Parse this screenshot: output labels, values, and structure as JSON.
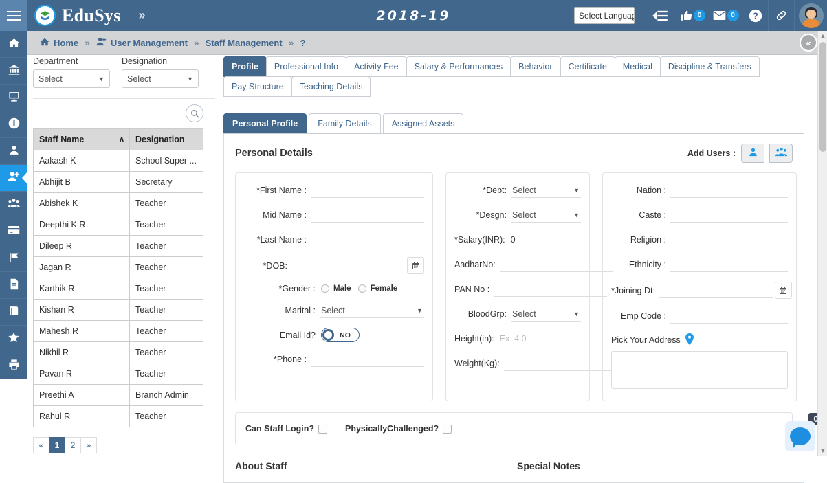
{
  "topbar": {
    "brand": "EduSys",
    "expand_icon": "chevron-double-right-icon",
    "year_title": "2018-19",
    "language_selector": {
      "value": "Select Languag",
      "caret": "▼"
    },
    "icons": [
      {
        "name": "list-menu-icon",
        "glyph": "≡"
      },
      {
        "name": "thumbs-up-icon",
        "glyph": "👍",
        "badge": "0"
      },
      {
        "name": "envelope-icon",
        "glyph": "✉",
        "badge": "0"
      },
      {
        "name": "help-icon",
        "glyph": "?"
      },
      {
        "name": "link-icon",
        "glyph": "🔗"
      }
    ],
    "avatar_name": "user-avatar"
  },
  "sidebar": {
    "items": [
      {
        "name": "home",
        "icon": "home-icon",
        "active": false
      },
      {
        "name": "institution",
        "icon": "bank-icon",
        "active": false
      },
      {
        "name": "dashboard",
        "icon": "monitor-icon",
        "active": false
      },
      {
        "name": "information",
        "icon": "info-icon",
        "active": false
      },
      {
        "name": "user",
        "icon": "user-icon",
        "active": false
      },
      {
        "name": "user-management",
        "icon": "user-plus-icon",
        "active": true
      },
      {
        "name": "groups",
        "icon": "users-group-icon",
        "active": false
      },
      {
        "name": "payments",
        "icon": "card-icon",
        "active": false
      },
      {
        "name": "reports-flag",
        "icon": "flag-icon",
        "active": false
      },
      {
        "name": "documents",
        "icon": "file-icon",
        "active": false
      },
      {
        "name": "library",
        "icon": "book-icon",
        "active": false
      },
      {
        "name": "favorites",
        "icon": "star-icon",
        "active": false
      },
      {
        "name": "print",
        "icon": "printer-icon",
        "active": false
      }
    ]
  },
  "breadcrumb": {
    "items": [
      {
        "label": "Home",
        "icon": "home-icon"
      },
      {
        "label": "User Management",
        "icon": "user-plus-icon"
      },
      {
        "label": "Staff Management",
        "icon": ""
      },
      {
        "label": "?",
        "icon": ""
      }
    ],
    "separator": "»",
    "collapse_button": "«"
  },
  "left_panel": {
    "filters": [
      {
        "label": "Department",
        "value": "Select"
      },
      {
        "label": "Designation",
        "value": "Select"
      }
    ],
    "search_icon": "search-icon",
    "table": {
      "headers": [
        "Staff Name",
        "Designation"
      ],
      "sort_indicator": "∧",
      "rows": [
        {
          "name": "Aakash K",
          "designation": "School Super ..."
        },
        {
          "name": "Abhijit B",
          "designation": "Secretary"
        },
        {
          "name": "Abishek K",
          "designation": "Teacher"
        },
        {
          "name": "Deepthi K R",
          "designation": "Teacher"
        },
        {
          "name": "Dileep R",
          "designation": "Teacher"
        },
        {
          "name": "Jagan R",
          "designation": "Teacher"
        },
        {
          "name": "Karthik R",
          "designation": "Teacher"
        },
        {
          "name": "Kishan R",
          "designation": "Teacher"
        },
        {
          "name": "Mahesh R",
          "designation": "Teacher"
        },
        {
          "name": "Nikhil R",
          "designation": "Teacher"
        },
        {
          "name": "Pavan R",
          "designation": "Teacher"
        },
        {
          "name": "Preethi A",
          "designation": "Branch Admin"
        },
        {
          "name": "Rahul R",
          "designation": "Teacher"
        }
      ]
    },
    "pagination": {
      "first": "«",
      "pages": [
        "1",
        "2"
      ],
      "active": "1",
      "last": "»"
    }
  },
  "main": {
    "outer_tabs": [
      {
        "label": "Profile",
        "active": true
      },
      {
        "label": "Professional Info",
        "active": false
      },
      {
        "label": "Activity Fee",
        "active": false
      },
      {
        "label": "Salary & Performances",
        "active": false
      },
      {
        "label": "Behavior",
        "active": false
      },
      {
        "label": "Certificate",
        "active": false
      },
      {
        "label": "Medical",
        "active": false
      },
      {
        "label": "Discipline & Transfers",
        "active": false
      },
      {
        "label": "Pay Structure",
        "active": false
      },
      {
        "label": "Teaching Details",
        "active": false
      }
    ],
    "sub_tabs": [
      {
        "label": "Personal Profile",
        "active": true
      },
      {
        "label": "Family Details",
        "active": false
      },
      {
        "label": "Assigned Assets",
        "active": false
      }
    ],
    "panel_title": "Personal Details",
    "add_users": {
      "label": "Add Users :",
      "single_icon": "add-single-user-icon",
      "group_icon": "add-group-users-icon"
    },
    "column1": {
      "first_name": {
        "label": "*First Name :",
        "value": ""
      },
      "mid_name": {
        "label": "Mid Name :",
        "value": ""
      },
      "last_name": {
        "label": "*Last Name :",
        "value": ""
      },
      "dob": {
        "label": "*DOB:",
        "value": "",
        "calendar_icon": "calendar-icon"
      },
      "gender": {
        "label": "*Gender :",
        "options": [
          "Male",
          "Female"
        ],
        "selected": ""
      },
      "marital": {
        "label": "Marital :",
        "value": "Select"
      },
      "email_id": {
        "label": "Email Id?",
        "toggle_state": "NO"
      },
      "phone": {
        "label": "*Phone :",
        "value": ""
      }
    },
    "column2": {
      "dept": {
        "label": "*Dept:",
        "value": "Select"
      },
      "desgn": {
        "label": "*Desgn:",
        "value": "Select"
      },
      "salary": {
        "label": "*Salary(INR):",
        "value": "0"
      },
      "aadhar": {
        "label": "AadharNo:",
        "value": ""
      },
      "pan": {
        "label": "PAN No :",
        "value": ""
      },
      "bloodgrp": {
        "label": "BloodGrp:",
        "value": "Select"
      },
      "height": {
        "label": "Height(in):",
        "value": "",
        "placeholder": "Ex: 4.0"
      },
      "weight": {
        "label": "Weight(Kg):",
        "value": ""
      }
    },
    "column3": {
      "nation": {
        "label": "Nation :",
        "value": ""
      },
      "caste": {
        "label": "Caste :",
        "value": ""
      },
      "religion": {
        "label": "Religion :",
        "value": ""
      },
      "ethnicity": {
        "label": "Ethnicity :",
        "value": ""
      },
      "joining_dt": {
        "label": "*Joining Dt:",
        "value": "",
        "calendar_icon": "calendar-icon"
      },
      "emp_code": {
        "label": "Emp Code :",
        "value": ""
      },
      "pick_address": {
        "label": "Pick Your Address",
        "icon": "map-pin-icon",
        "value": ""
      }
    },
    "checkboxes": [
      {
        "label": "Can Staff Login?",
        "checked": false
      },
      {
        "label": "PhysicallyChallenged?",
        "checked": false
      }
    ],
    "bottom_sections": [
      {
        "title": "About Staff"
      },
      {
        "title": "Special Notes"
      }
    ]
  },
  "chat_widget": {
    "icon": "chat-bubble-icon",
    "badge": "0"
  },
  "colors": {
    "header_blue": "#41678d",
    "accent_blue": "#1e9ae6",
    "breadcrumb_grey": "#d2d4d6",
    "table_header_grey": "#d9d9d9"
  }
}
